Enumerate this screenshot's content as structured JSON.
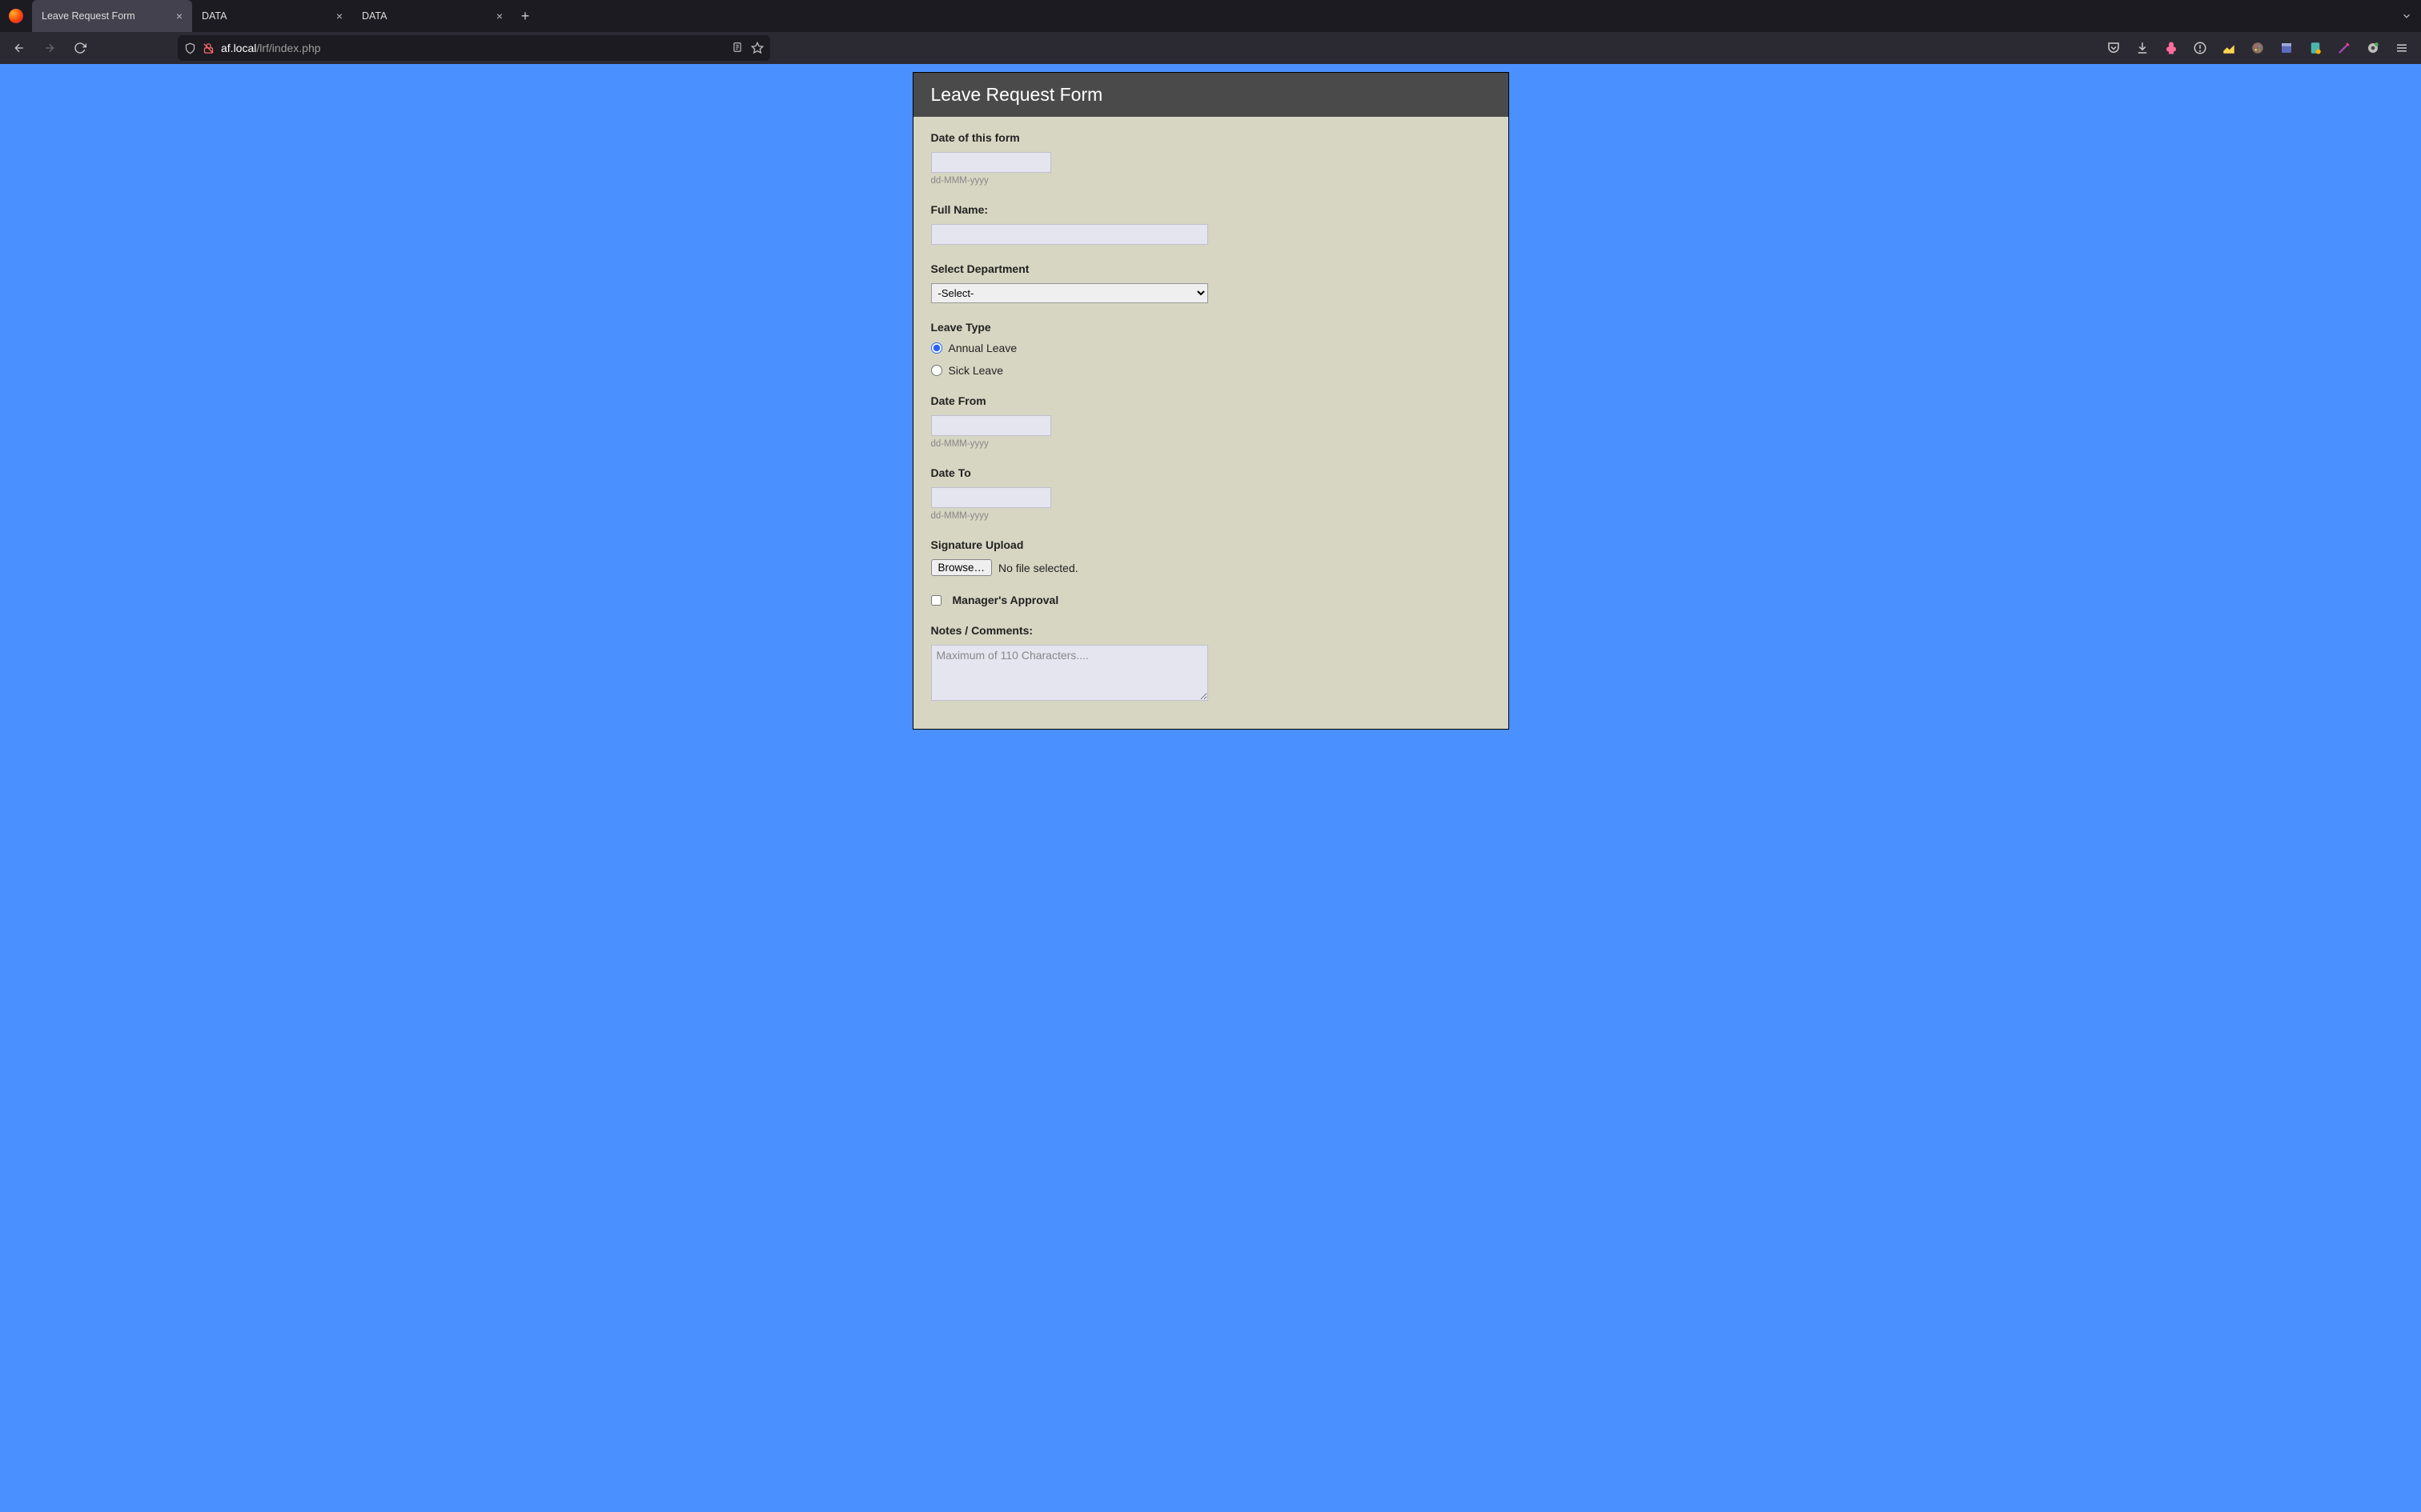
{
  "browser": {
    "tabs": [
      {
        "title": "Leave Request Form",
        "active": true
      },
      {
        "title": "DATA",
        "active": false
      },
      {
        "title": "DATA",
        "active": false
      }
    ],
    "url_host": "af.local",
    "url_path": "/lrf/index.php"
  },
  "form": {
    "title": "Leave Request Form",
    "date_of_form": {
      "label": "Date of this form",
      "value": "",
      "hint": "dd-MMM-yyyy"
    },
    "full_name": {
      "label": "Full Name:",
      "value": ""
    },
    "department": {
      "label": "Select Department",
      "selected": "-Select-"
    },
    "leave_type": {
      "label": "Leave Type",
      "options": [
        {
          "label": "Annual Leave",
          "checked": true
        },
        {
          "label": "Sick Leave",
          "checked": false
        }
      ]
    },
    "date_from": {
      "label": "Date From",
      "value": "",
      "hint": "dd-MMM-yyyy"
    },
    "date_to": {
      "label": "Date To",
      "value": "",
      "hint": "dd-MMM-yyyy"
    },
    "signature": {
      "label": "Signature Upload",
      "button": "Browse…",
      "status": "No file selected."
    },
    "approval": {
      "label": "Manager's Approval",
      "checked": false
    },
    "notes": {
      "label": "Notes / Comments:",
      "placeholder": "Maximum of 110 Characters....",
      "value": ""
    }
  }
}
